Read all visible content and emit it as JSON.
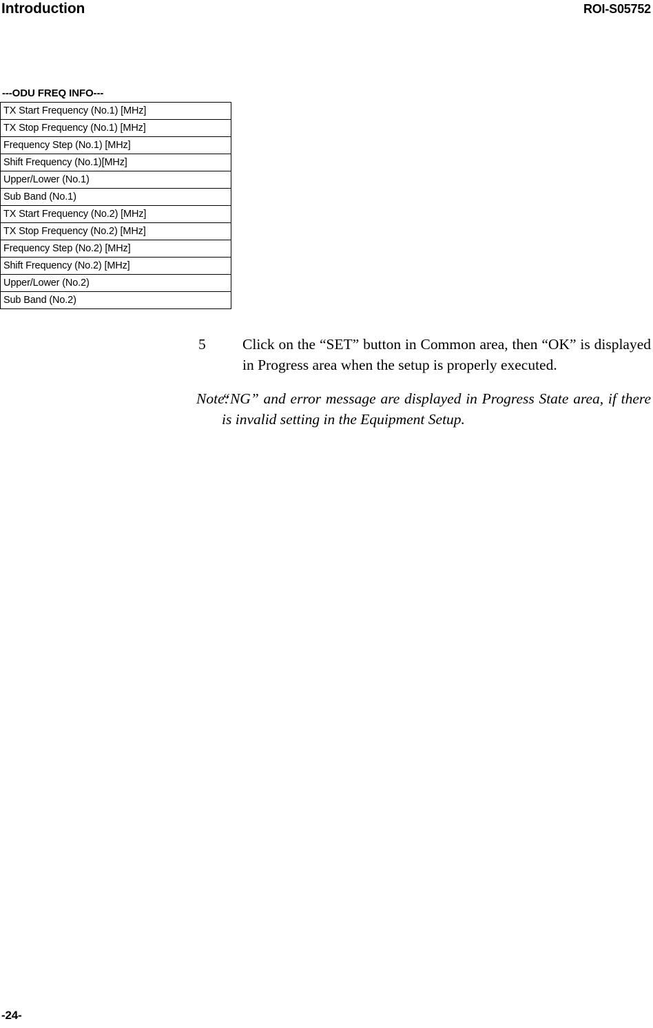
{
  "header": {
    "title": "Introduction",
    "doc_id": "ROI-S05752"
  },
  "odu_section": {
    "caption": "---ODU FREQ INFO---",
    "rows": [
      "TX Start Frequency (No.1) [MHz]",
      "TX Stop Frequency (No.1) [MHz]",
      "Frequency Step (No.1) [MHz]",
      "Shift Frequency (No.1)[MHz]",
      "Upper/Lower (No.1)",
      "Sub Band (No.1)",
      "TX Start Frequency (No.2) [MHz]",
      "TX Stop Frequency (No.2) [MHz]",
      "Frequency Step (No.2) [MHz]",
      "Shift Frequency (No.2) [MHz]",
      "Upper/Lower (No.2)",
      "Sub Band (No.2)"
    ]
  },
  "step": {
    "number": "5",
    "text": "Click on the “SET” button in Common area, then “OK” is displayed in Progress area when the setup is properly executed."
  },
  "note": {
    "label": "Note:",
    "text": "“NG” and error message are displayed in Progress State area, if there is invalid setting in the Equipment Setup."
  },
  "footer": {
    "page_number": "-24-"
  }
}
